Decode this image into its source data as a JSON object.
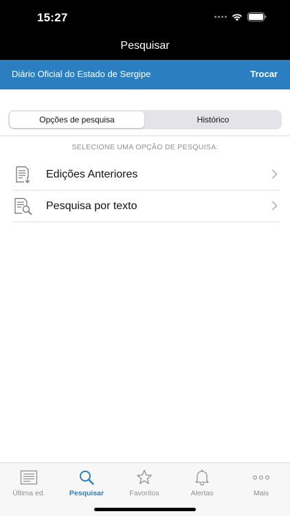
{
  "status_bar": {
    "time": "15:27"
  },
  "nav": {
    "title": "Pesquisar"
  },
  "journal": {
    "name": "Diário Oficial do Estado de Sergipe",
    "change_label": "Trocar"
  },
  "segments": [
    {
      "label": "Opções de pesquisa",
      "selected": true
    },
    {
      "label": "Histórico",
      "selected": false
    }
  ],
  "section_hint": "SELECIONE UMA OPÇÃO DE PESQUISA:",
  "options": [
    {
      "label": "Edições Anteriores",
      "icon": "document-download-icon"
    },
    {
      "label": "Pesquisa por texto",
      "icon": "document-search-icon"
    }
  ],
  "tabs": [
    {
      "label": "Última ed.",
      "icon": "newspaper-icon",
      "active": false
    },
    {
      "label": "Pesquisar",
      "icon": "search-icon",
      "active": true
    },
    {
      "label": "Favoritos",
      "icon": "star-icon",
      "active": false
    },
    {
      "label": "Alertas",
      "icon": "bell-icon",
      "active": false
    },
    {
      "label": "Mais",
      "icon": "more-icon",
      "active": false
    }
  ],
  "colors": {
    "accent": "#2b7fc1",
    "inactive": "#8e8e93"
  }
}
